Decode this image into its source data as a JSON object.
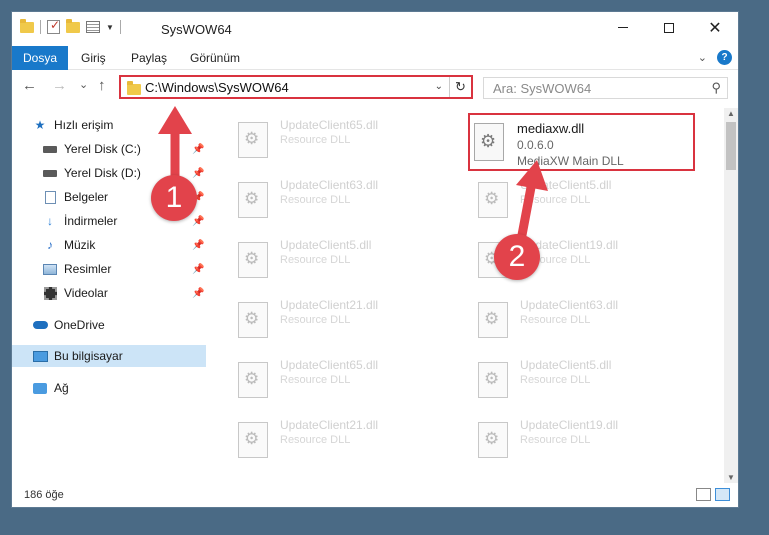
{
  "window": {
    "title": "SysWOW64"
  },
  "titlebar": {
    "minimize": "",
    "maximize": "",
    "close": "✕"
  },
  "ribbon": {
    "tabs": [
      "Dosya",
      "Giriş",
      "Paylaş",
      "Görünüm"
    ],
    "help": "?"
  },
  "navigation": {
    "back": "←",
    "forward": "→",
    "recent": "⌄",
    "up": "↑",
    "address": "C:\\Windows\\SysWOW64",
    "search_placeholder": "Ara: SysWOW64"
  },
  "sidebar": {
    "items": [
      {
        "label": "Hızlı erişim",
        "icon": "star-icon"
      },
      {
        "label": "Yerel Disk (C:)",
        "icon": "disk-icon",
        "pinned": true
      },
      {
        "label": "Yerel Disk (D:)",
        "icon": "disk-icon",
        "pinned": true
      },
      {
        "label": "Belgeler",
        "icon": "documents-icon",
        "pinned": true
      },
      {
        "label": "İndirmeler",
        "icon": "download-icon",
        "pinned": true
      },
      {
        "label": "Müzik",
        "icon": "music-icon",
        "pinned": true
      },
      {
        "label": "Resimler",
        "icon": "pictures-icon",
        "pinned": true
      },
      {
        "label": "Videolar",
        "icon": "video-icon",
        "pinned": true
      },
      {
        "label": "OneDrive",
        "icon": "cloud-icon"
      },
      {
        "label": "Bu bilgisayar",
        "icon": "computer-icon",
        "selected": true
      },
      {
        "label": "Ağ",
        "icon": "network-icon"
      }
    ]
  },
  "files": {
    "highlighted": {
      "name": "mediaxw.dll",
      "version": "0.0.6.0",
      "description": "MediaXW Main DLL"
    },
    "left": [
      {
        "name": "UpdateClient65.dll",
        "sub": "Resource DLL"
      },
      {
        "name": "UpdateClient63.dll",
        "sub": "Resource DLL"
      },
      {
        "name": "UpdateClient5.dll",
        "sub": "Resource DLL"
      },
      {
        "name": "UpdateClient21.dll",
        "sub": "Resource DLL"
      },
      {
        "name": "UpdateClient65.dll",
        "sub": "Resource DLL"
      },
      {
        "name": "UpdateClient21.dll",
        "sub": "Resource DLL"
      }
    ],
    "right": [
      {
        "name": "UpdateClient5.dll",
        "sub": "Resource DLL"
      },
      {
        "name": "UpdateClient19.dll",
        "sub": "Resource DLL"
      },
      {
        "name": "UpdateClient63.dll",
        "sub": "Resource DLL"
      },
      {
        "name": "UpdateClient5.dll",
        "sub": "Resource DLL"
      },
      {
        "name": "UpdateClient19.dll",
        "sub": "Resource DLL"
      }
    ]
  },
  "status": {
    "count": "186 öğe"
  },
  "annotations": {
    "step1": "1",
    "step2": "2"
  },
  "colors": {
    "accent": "#1979ca",
    "highlight": "#d9333f",
    "badge": "#e2434b"
  }
}
